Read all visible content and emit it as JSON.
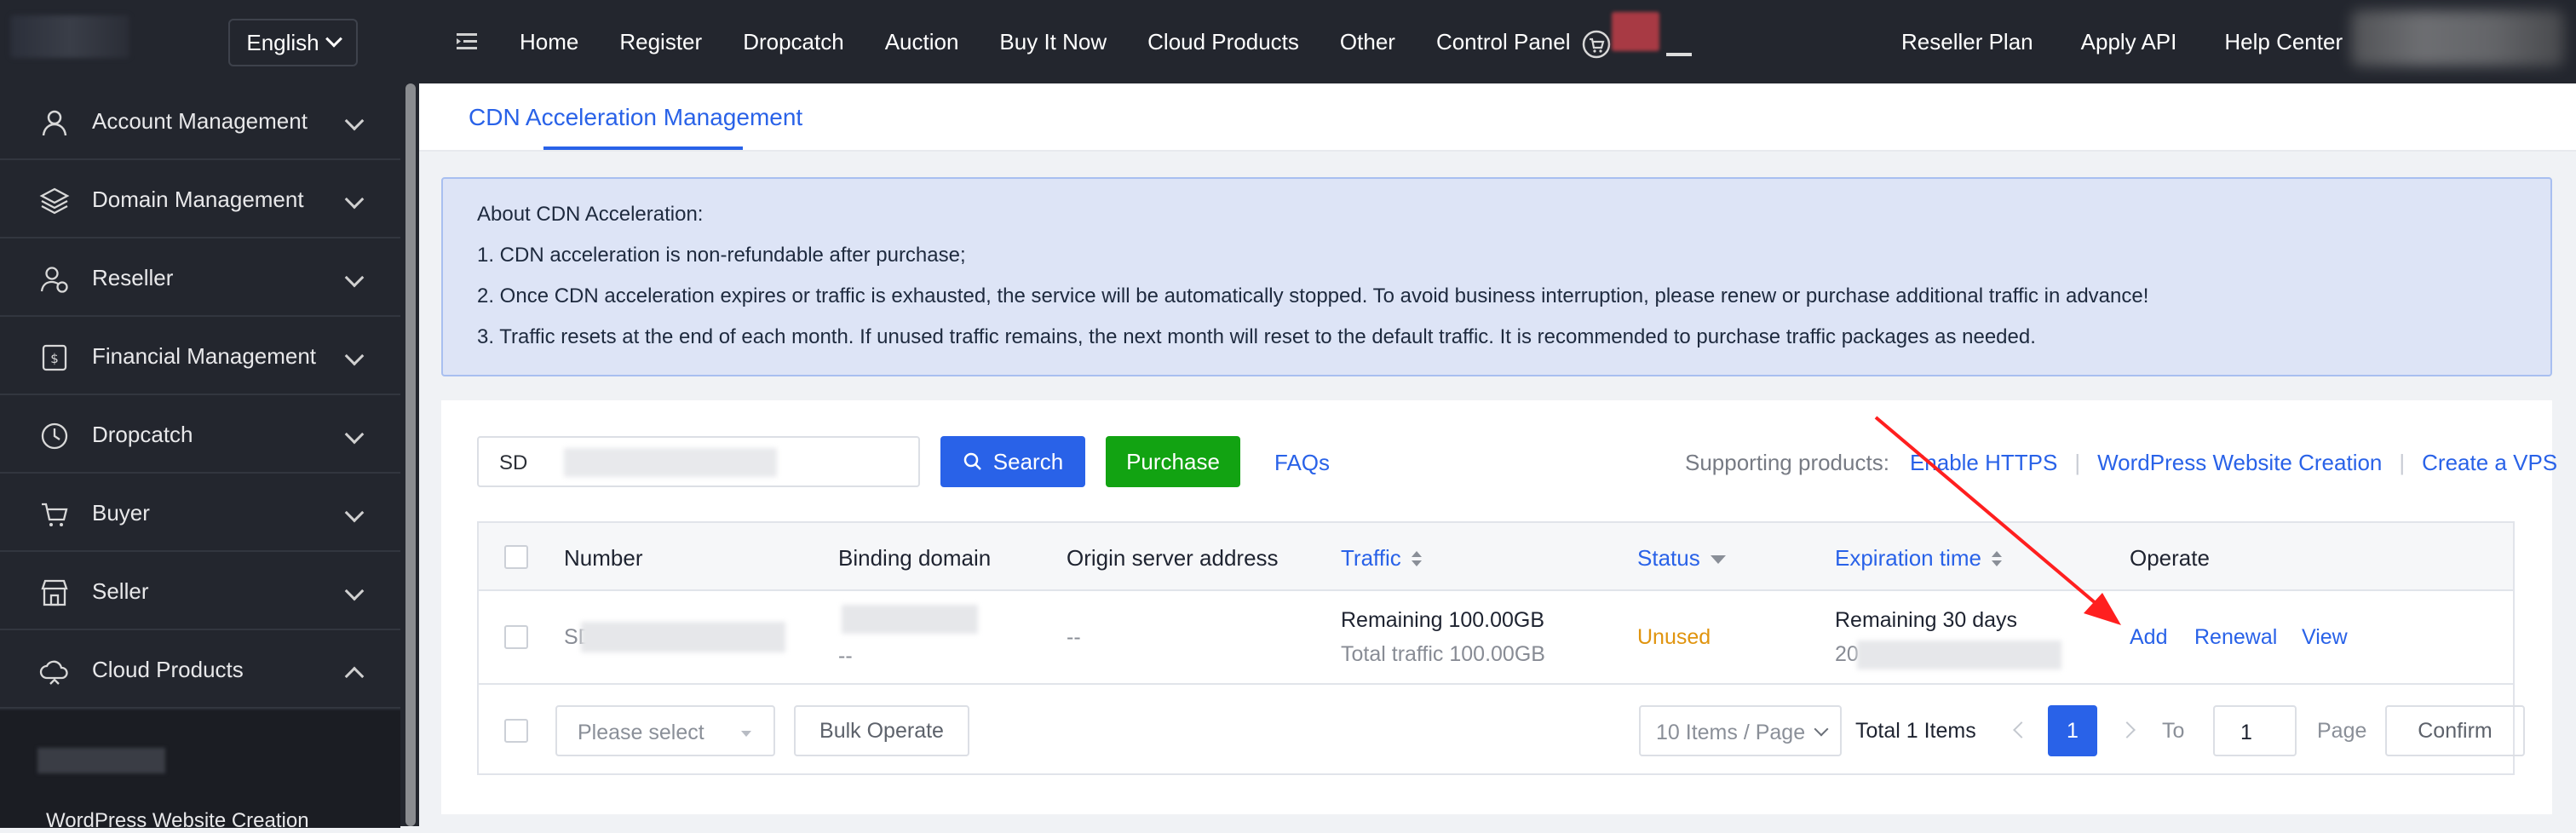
{
  "header": {
    "language": "English",
    "nav": [
      "Home",
      "Register",
      "Dropcatch",
      "Auction",
      "Buy It Now",
      "Cloud Products",
      "Other",
      "Control Panel"
    ],
    "right_nav": [
      "Reseller Plan",
      "Apply API",
      "Help Center"
    ]
  },
  "sidebar": {
    "items": [
      {
        "label": "Account Management",
        "icon": "user-icon"
      },
      {
        "label": "Domain Management",
        "icon": "layers-icon"
      },
      {
        "label": "Reseller",
        "icon": "reseller-icon"
      },
      {
        "label": "Financial Management",
        "icon": "dollar-icon"
      },
      {
        "label": "Dropcatch",
        "icon": "clock-icon"
      },
      {
        "label": "Buyer",
        "icon": "cart-icon"
      },
      {
        "label": "Seller",
        "icon": "store-icon"
      },
      {
        "label": "Cloud Products",
        "icon": "cloud-icon"
      }
    ],
    "sub_item": "WordPress Website Creation"
  },
  "page": {
    "tab": "CDN Acceleration Management"
  },
  "notice": {
    "title": "About CDN Acceleration:",
    "lines": [
      "1. CDN acceleration is non-refundable after purchase;",
      "2. Once CDN acceleration expires or traffic is exhausted, the service will be automatically stopped. To avoid business interruption, please renew or purchase additional traffic in advance!",
      "3. Traffic resets at the end of each month. If unused traffic remains, the next month will reset to the default traffic. It is recommended to purchase traffic packages as needed."
    ]
  },
  "toolbar": {
    "search_value": "SD",
    "search_label": "Search",
    "purchase_label": "Purchase",
    "faqs_label": "FAQs",
    "supporting_label": "Supporting products:",
    "supporting_links": [
      "Enable HTTPS",
      "WordPress Website Creation",
      "Create a VPS"
    ]
  },
  "table": {
    "headers": [
      "Number",
      "Binding domain",
      "Origin server address",
      "Traffic",
      "Status",
      "Expiration time",
      "Operate"
    ],
    "rows": [
      {
        "number": "SD",
        "binding_domain_line2": "--",
        "origin": "--",
        "traffic_remaining": "Remaining 100.00GB",
        "traffic_total": "Total traffic 100.00GB",
        "status": "Unused",
        "expiration_remaining": "Remaining 30 days",
        "expiration_date": "20",
        "operations": [
          "Add",
          "Renewal",
          "View"
        ]
      }
    ]
  },
  "footer": {
    "bulk_select_placeholder": "Please select",
    "bulk_operate_label": "Bulk Operate",
    "page_size": "10 Items / Page",
    "total": "Total 1 Items",
    "current_page": "1",
    "to_label": "To",
    "page_input": "1",
    "page_label": "Page",
    "confirm_label": "Confirm"
  },
  "colors": {
    "accent": "#2962e8",
    "purchase": "#12a312",
    "unused_status": "#e0940e",
    "annotation_arrow": "#ff1f1f"
  }
}
